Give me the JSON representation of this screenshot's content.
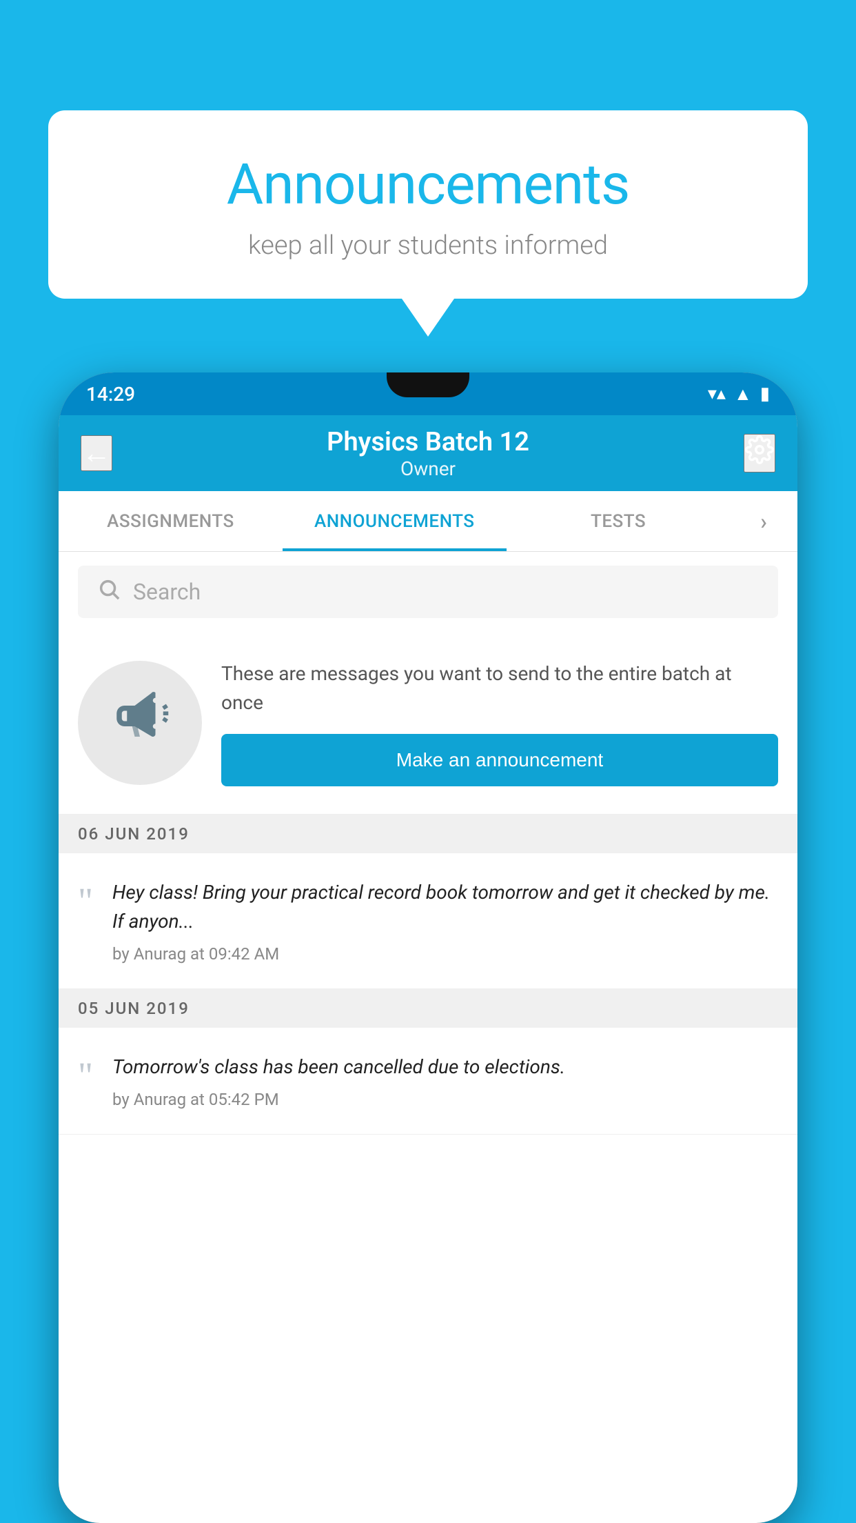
{
  "background_color": "#1ab7ea",
  "speech_bubble": {
    "title": "Announcements",
    "subtitle": "keep all your students informed"
  },
  "status_bar": {
    "time": "14:29",
    "wifi_icon": "▼",
    "signal_icon": "◢",
    "battery_icon": "▮"
  },
  "app_bar": {
    "title": "Physics Batch 12",
    "subtitle": "Owner",
    "back_label": "←",
    "settings_label": "⚙"
  },
  "tabs": [
    {
      "label": "ASSIGNMENTS",
      "active": false
    },
    {
      "label": "ANNOUNCEMENTS",
      "active": true
    },
    {
      "label": "TESTS",
      "active": false
    },
    {
      "label": "⋯",
      "active": false
    }
  ],
  "search": {
    "placeholder": "Search"
  },
  "announcement_prompt": {
    "description": "These are messages you want to send to the entire batch at once",
    "button_label": "Make an announcement"
  },
  "date_groups": [
    {
      "date": "06  JUN  2019",
      "items": [
        {
          "message": "Hey class! Bring your practical record book tomorrow and get it checked by me. If anyon...",
          "meta": "by Anurag at 09:42 AM"
        }
      ]
    },
    {
      "date": "05  JUN  2019",
      "items": [
        {
          "message": "Tomorrow's class has been cancelled due to elections.",
          "meta": "by Anurag at 05:42 PM"
        }
      ]
    }
  ]
}
